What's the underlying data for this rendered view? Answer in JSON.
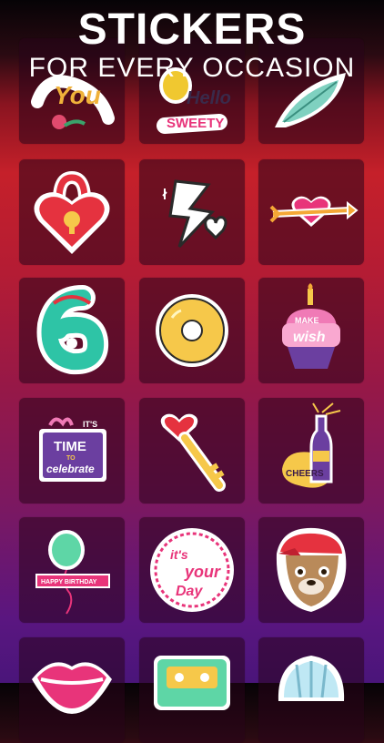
{
  "header": {
    "title": "STICKERS",
    "subtitle": "FOR EVERY OCCASION"
  },
  "colors": {
    "accent_pink": "#e8347a",
    "accent_teal": "#2ec4a6",
    "accent_yellow": "#f6c84a",
    "accent_purple": "#6b3fa0"
  },
  "stickers": [
    {
      "name": "you-script",
      "text": "You"
    },
    {
      "name": "hello-sweety",
      "text_1": "Hello",
      "text_2": "SWEETY"
    },
    {
      "name": "feather"
    },
    {
      "name": "heart-padlock"
    },
    {
      "name": "lightning-heart"
    },
    {
      "name": "heart-arrow"
    },
    {
      "name": "number-six"
    },
    {
      "name": "donut"
    },
    {
      "name": "make-a-wish-cupcake",
      "text_1": "MAKE",
      "text_2": "wish"
    },
    {
      "name": "time-to-celebrate-gift",
      "text_1": "IT'S",
      "text_2": "TIME",
      "text_3": "TO",
      "text_4": "celebrate"
    },
    {
      "name": "heart-key"
    },
    {
      "name": "cheers-champagne",
      "text": "CHEERS"
    },
    {
      "name": "happy-birthday-balloon",
      "text": "HAPPY BIRTHDAY"
    },
    {
      "name": "its-your-day",
      "text_1": "it's",
      "text_2": "your",
      "text_3": "Day"
    },
    {
      "name": "bulldog-cap"
    },
    {
      "name": "lips"
    },
    {
      "name": "cassette"
    },
    {
      "name": "seashell"
    }
  ]
}
